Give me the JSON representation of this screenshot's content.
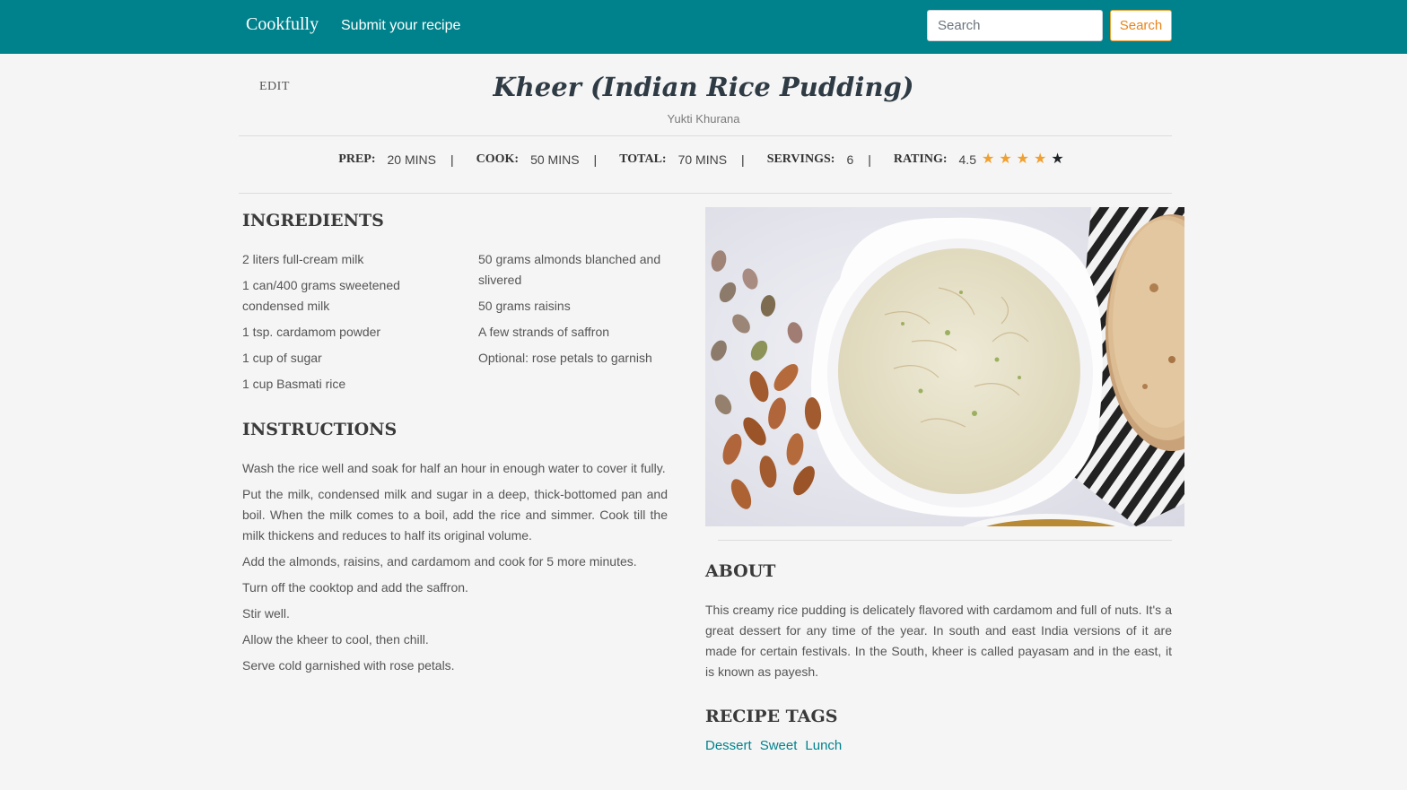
{
  "nav": {
    "brand": "Cookfully",
    "submit_link": "Submit your recipe",
    "search_placeholder": "Search",
    "search_button": "Search"
  },
  "recipe": {
    "edit_label": "EDIT",
    "title": "Kheer (Indian Rice Pudding)",
    "author": "Yukti Khurana",
    "meta": {
      "prep_label": "PREP:",
      "prep_value": "20 MINS",
      "cook_label": "COOK:",
      "cook_value": "50 MINS",
      "total_label": "TOTAL:",
      "total_value": "70 MINS",
      "servings_label": "SERVINGS:",
      "servings_value": "6",
      "rating_label": "RATING:",
      "rating_value": "4.5",
      "separator": "|",
      "rating_stars": 4.5,
      "star_glyph": "★"
    },
    "ingredients_heading": "INGREDIENTS",
    "ingredients_left": [
      "2 liters full-cream milk",
      "1 can/400 grams sweetened condensed milk",
      "1 tsp. cardamom powder",
      "1 cup of sugar",
      "1 cup Basmati rice"
    ],
    "ingredients_right": [
      "50 grams almonds blanched and slivered",
      "50 grams raisins",
      "A few strands of saffron",
      "Optional: rose petals to garnish"
    ],
    "instructions_heading": "INSTRUCTIONS",
    "instructions": [
      "Wash the rice well and soak for half an hour in enough water to cover it fully.",
      "Put the milk, condensed milk and sugar in a deep, thick-bottomed pan and boil. When the milk comes to a boil, add the rice and simmer. Cook till the milk thickens and reduces to half its original volume.",
      "Add the almonds, raisins, and cardamom and cook for 5 more minutes.",
      "Turn off the cooktop and add the saffron.",
      "Stir well.",
      "Allow the kheer to cool, then chill.",
      "Serve cold garnished with rose petals."
    ],
    "about_heading": "ABOUT",
    "about_text": "This creamy rice pudding is delicately flavored with cardamom and full of nuts. It's a great dessert for any time of the year. In south and east India versions of it are made for certain festivals. In the South, kheer is called payasam and in the east, it is known as payesh.",
    "tags_heading": "RECIPE TAGS",
    "tags": [
      "Dessert",
      "Sweet",
      "Lunch"
    ]
  },
  "colors": {
    "navbar": "#00828c",
    "accent_orange": "#f0a030",
    "tag_link": "#00828c",
    "background": "#f5f5f5"
  },
  "icons": {
    "star_filled": "star-icon",
    "search": "search-button"
  }
}
